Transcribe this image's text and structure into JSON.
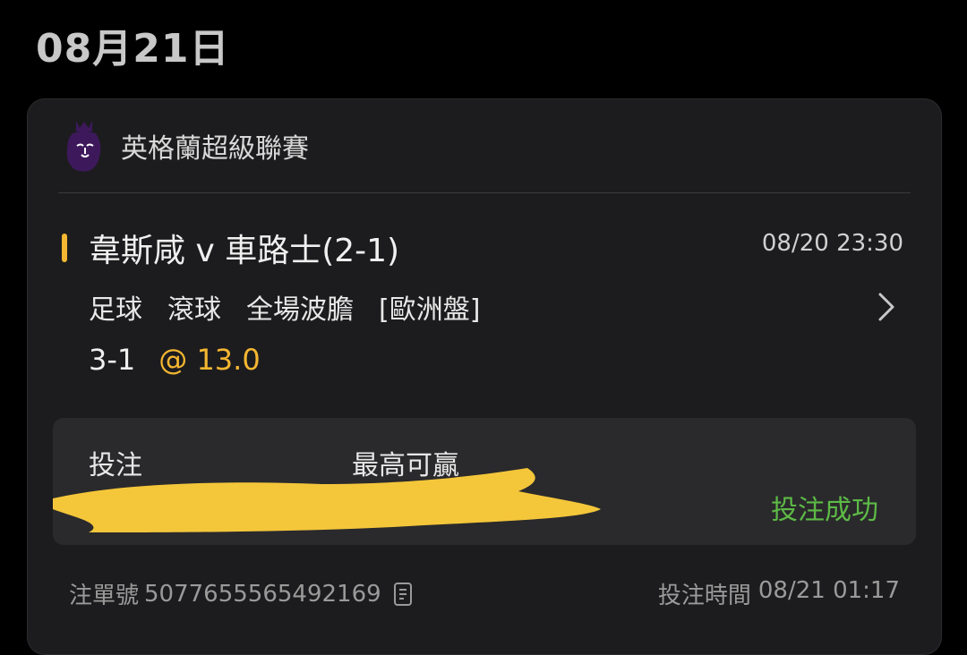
{
  "date_header": "08月21日",
  "colors": {
    "background": "#000000",
    "card": "#1c1c1e",
    "accent": "#f5b731",
    "success": "#5dbb46",
    "league_logo": "#3d195b"
  },
  "league": {
    "icon": "premier-league-lion-icon",
    "name": "英格蘭超級聯賽"
  },
  "match": {
    "title": "韋斯咸 v 車路士(2-1)",
    "time": "08/20 23:30",
    "sport": "足球",
    "mode": "滾球",
    "market": "全場波膽",
    "odds_type": "[歐洲盤]",
    "selection": "3-1",
    "odds": "@ 13.0"
  },
  "stake_panel": {
    "stake_label": "投注",
    "max_win_label": "最高可贏",
    "status": "投注成功"
  },
  "footer": {
    "bet_no_label": "注單號",
    "bet_no": "5077655565492169",
    "bet_time_label": "投注時間",
    "bet_time": "08/21 01:17"
  }
}
